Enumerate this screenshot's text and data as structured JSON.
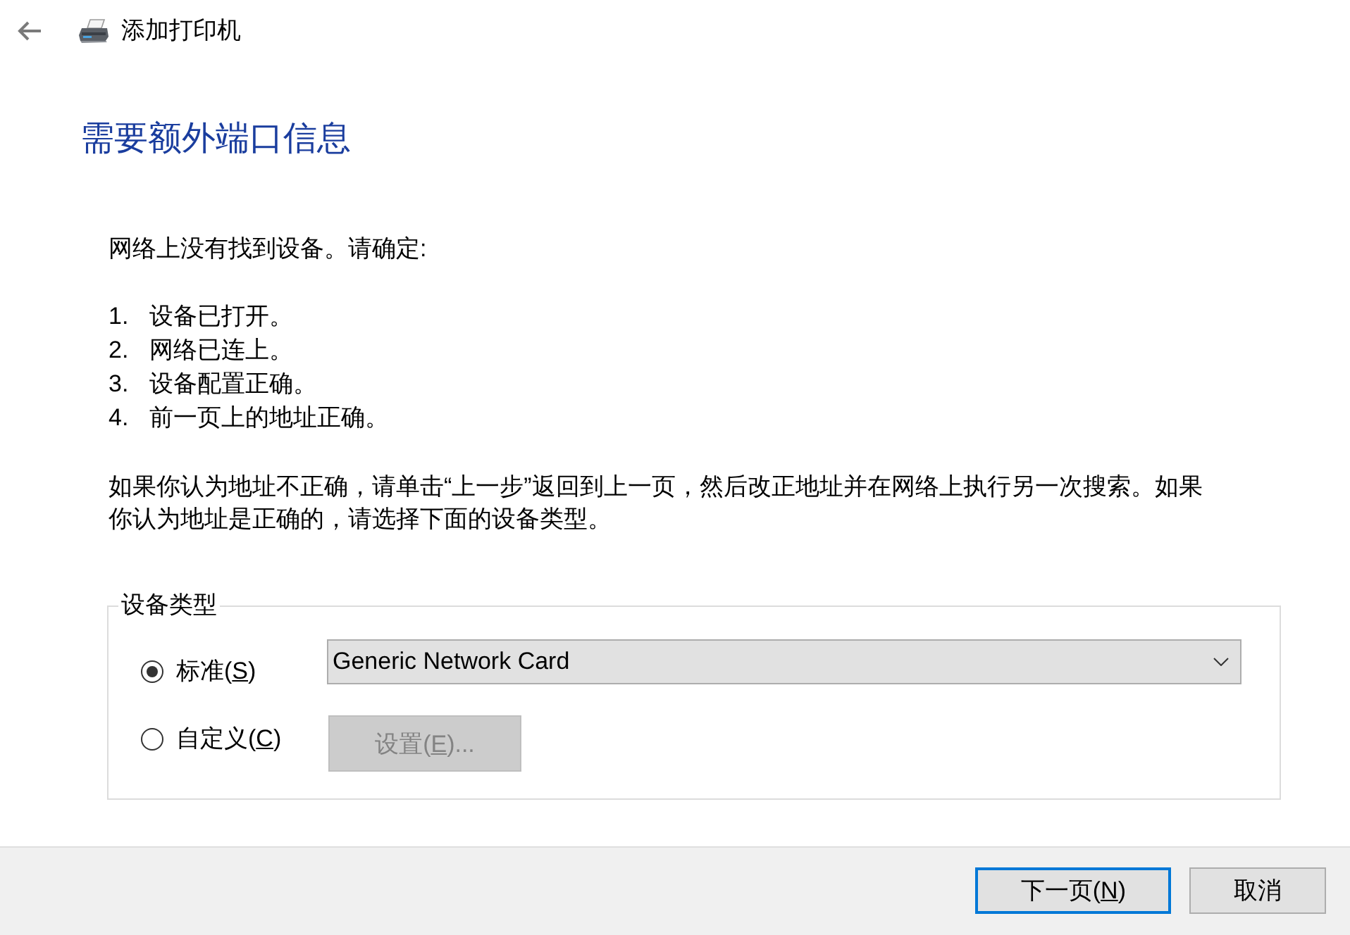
{
  "window": {
    "title": "添加打印机"
  },
  "heading": "需要额外端口信息",
  "intro": "网络上没有找到设备。请确定:",
  "checklist": [
    {
      "number": "1.",
      "text": "设备已打开。"
    },
    {
      "number": "2.",
      "text": "网络已连上。"
    },
    {
      "number": "3.",
      "text": "设备配置正确。"
    },
    {
      "number": "4.",
      "text": "前一页上的地址正确。"
    }
  ],
  "instructions": "如果你认为地址不正确，请单击“上一步”返回到上一页，然后改正地址并在网络上执行另一次搜索。如果你认为地址是正确的，请选择下面的设备类型。",
  "device_type": {
    "legend": "设备类型",
    "options": [
      {
        "label": "标准(",
        "access_key": "S",
        "label_end": ")",
        "selected": true,
        "control": {
          "kind": "dropdown",
          "value": "Generic Network Card"
        }
      },
      {
        "label": "自定义(",
        "access_key": "C",
        "label_end": ")",
        "selected": false,
        "control": {
          "kind": "button",
          "label": "设置(",
          "access_key": "E",
          "label_end": ")...",
          "disabled": true
        }
      }
    ]
  },
  "buttons": [
    {
      "label": "下一页(",
      "access_key": "N",
      "label_end": ")",
      "default": true
    },
    {
      "label": "取消",
      "default": false
    }
  ]
}
